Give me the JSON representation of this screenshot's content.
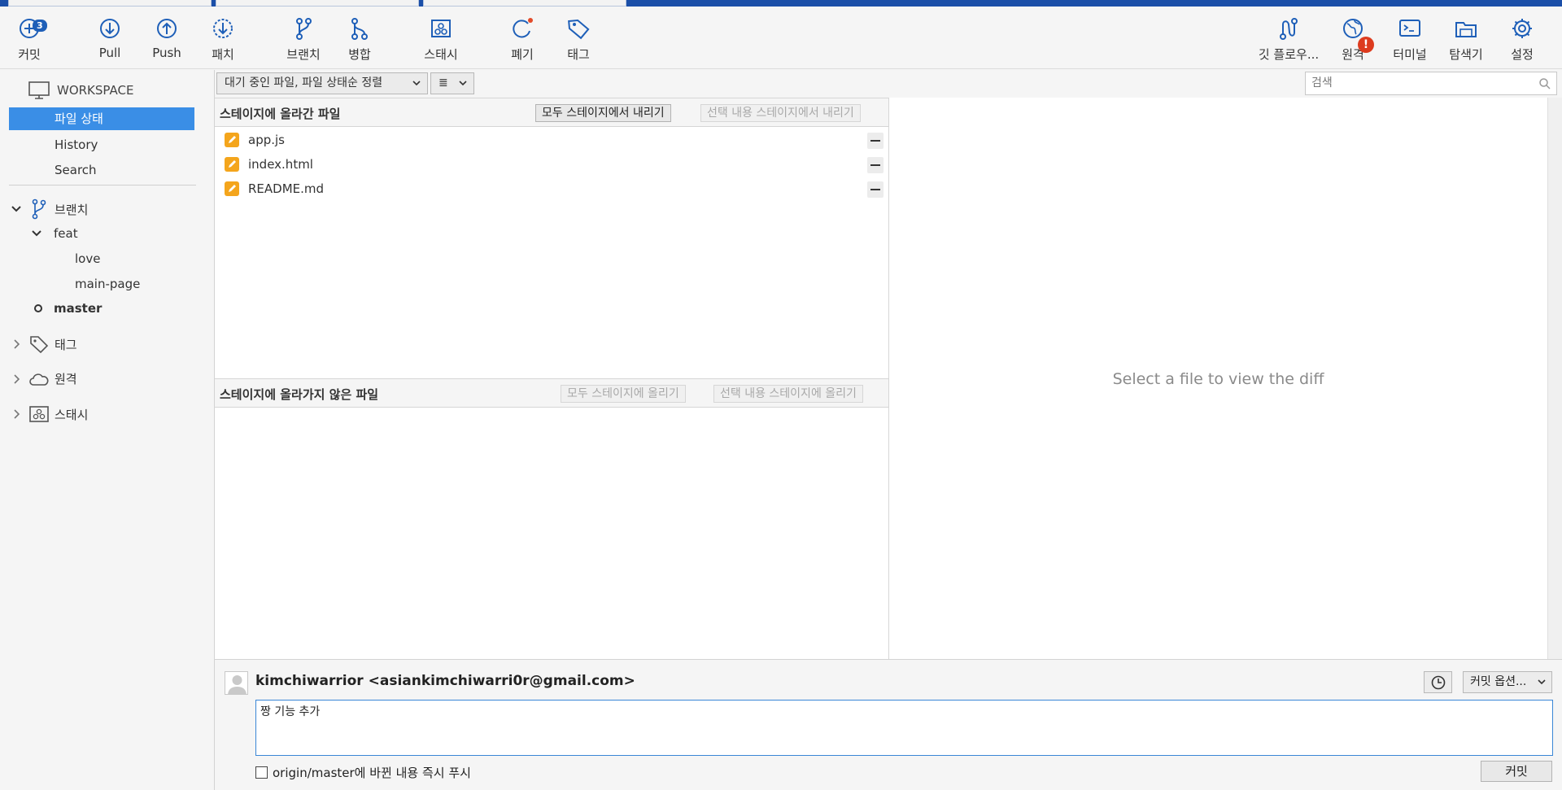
{
  "toolbar": {
    "commit": "커밋",
    "commit_badge": "3",
    "pull": "Pull",
    "push": "Push",
    "patch": "패치",
    "branch": "브랜치",
    "merge": "병합",
    "stash": "스태시",
    "discard": "폐기",
    "tag": "태그",
    "git_flow": "깃 플로우...",
    "remote": "원격",
    "remote_alert": "!",
    "terminal": "터미널",
    "explorer": "탐색기",
    "settings": "설정"
  },
  "sidebar": {
    "workspace": "WORKSPACE",
    "items": [
      "파일 상태",
      "History",
      "Search"
    ],
    "branches": "브랜치",
    "folder": "feat",
    "feat_children": [
      "love",
      "main-page"
    ],
    "master": "master",
    "tags": "태그",
    "remotes": "원격",
    "stashes": "스태시"
  },
  "filter": {
    "sort_label": "대기 중인 파일, 파일 상태순 정렬",
    "view_icon": "≣",
    "search_placeholder": "검색"
  },
  "staged": {
    "title": "스테이지에 올라간 파일",
    "unstage_all": "모두 스테이지에서 내리기",
    "unstage_selected": "선택 내용 스테이지에서 내리기",
    "files": [
      "app.js",
      "index.html",
      "README.md"
    ]
  },
  "unstaged": {
    "title": "스테이지에 올라가지 않은 파일",
    "stage_all": "모두 스테이지에 올리기",
    "stage_selected": "선택 내용 스테이지에 올리기"
  },
  "diff": {
    "placeholder": "Select a file to view the diff"
  },
  "commit": {
    "author": "kimchiwarrior <asiankimchiwarri0r@gmail.com>",
    "options": "커밋 옵션...",
    "message": "짱 기능 추가",
    "push_label": "origin/master에 바뀐 내용 즉시 푸시",
    "button": "커밋"
  },
  "colors": {
    "accent": "#3a8ee6",
    "icon": "#1e5fb8",
    "modified": "#f4a51c",
    "alert": "#dd3b1e"
  }
}
